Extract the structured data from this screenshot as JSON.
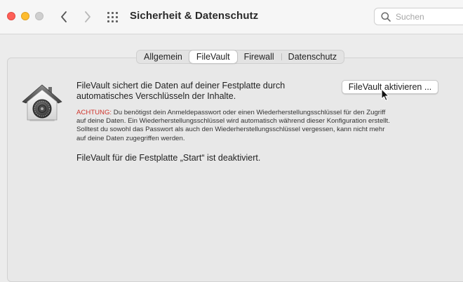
{
  "window": {
    "title": "Sicherheit & Datenschutz"
  },
  "toolbar": {
    "back_icon": "chevron-left-icon",
    "forward_icon": "chevron-right-icon",
    "grid_icon": "show-all-grid-icon",
    "search": {
      "placeholder": "Suchen",
      "value": ""
    }
  },
  "tabs": [
    {
      "label": "Allgemein",
      "selected": false
    },
    {
      "label": "FileVault",
      "selected": true
    },
    {
      "label": "Firewall",
      "selected": false
    },
    {
      "label": "Datenschutz",
      "selected": false
    }
  ],
  "filevault": {
    "icon": "filevault-house-safe-icon",
    "description_lines": [
      "FileVault sichert die Daten auf deiner Festplatte durch",
      "automatisches Verschlüsseln der Inhalte."
    ],
    "warning_label": "ACHTUNG:",
    "warning_lines": [
      " Du benötigst dein Anmeldepasswort oder einen Wiederherstellungsschlüssel für den Zugriff",
      "auf deine Daten. Ein Wiederherstellungsschlüssel wird automatisch während dieser Konfiguration erstellt.",
      "Solltest du sowohl das Passwort als auch den Wiederherstellungsschlüssel vergessen, kann nicht mehr",
      "auf deine Daten zugegriffen werden."
    ],
    "status": "FileVault für die Festplatte „Start“ ist deaktiviert.",
    "activate_button": "FileVault aktivieren ..."
  },
  "colors": {
    "warning": "#d0342c",
    "close": "#fe5f57",
    "minimize": "#febc2e",
    "zoom_inactive": "#cfcfcf"
  }
}
